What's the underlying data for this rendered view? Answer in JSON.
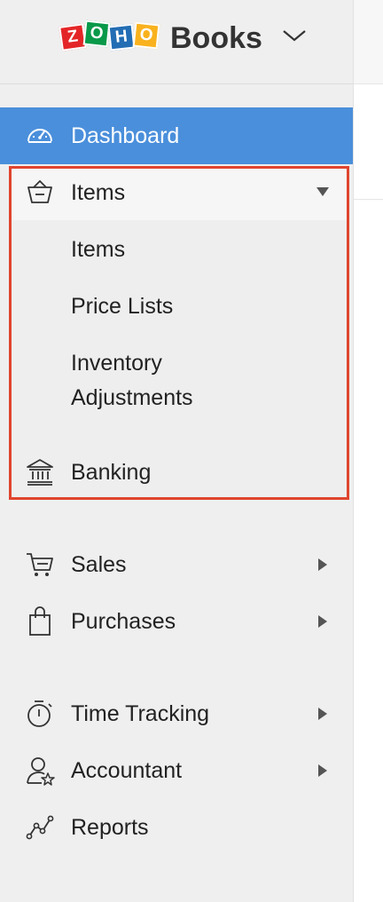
{
  "brand": {
    "logo_letters": [
      "Z",
      "O",
      "H",
      "O"
    ],
    "logo_colors": [
      "#e42527",
      "#089949",
      "#226db4",
      "#f9b21d"
    ],
    "product": "Books"
  },
  "nav": {
    "dashboard": "Dashboard",
    "items": "Items",
    "items_sub": [
      "Items",
      "Price Lists",
      "Inventory",
      "Adjustments"
    ],
    "banking": "Banking",
    "sales": "Sales",
    "purchases": "Purchases",
    "time_tracking": "Time Tracking",
    "accountant": "Accountant",
    "reports": "Reports"
  },
  "colors": {
    "active": "#4a8fdb",
    "highlight": "#e0452e",
    "sidebar_bg": "#efefef"
  }
}
